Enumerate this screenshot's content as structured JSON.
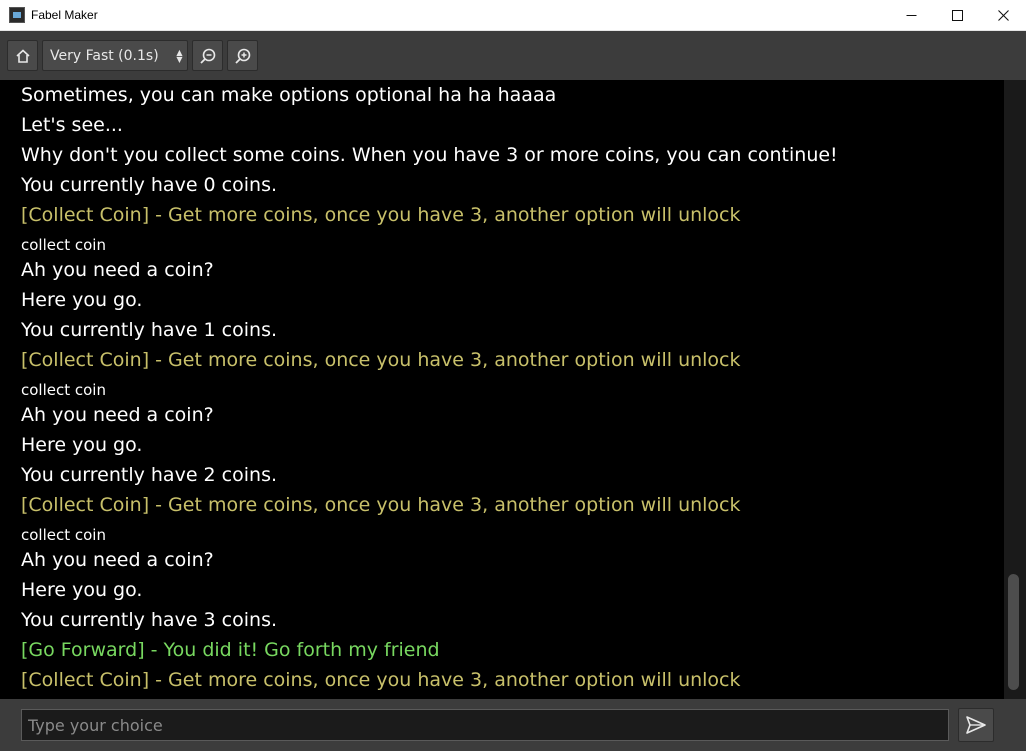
{
  "window": {
    "title": "Fabel Maker",
    "controls": {
      "minimize": "—",
      "maximize": "☐",
      "close": "✕"
    }
  },
  "toolbar": {
    "home_icon": "home-icon",
    "speed": {
      "selected": "Very Fast (0.1s)"
    },
    "zoom_out_icon": "zoom-out-icon",
    "zoom_in_icon": "zoom-in-icon"
  },
  "log": {
    "lines": [
      {
        "text": "Sometimes, you can make options optional ha ha haaaa",
        "kind": "narration"
      },
      {
        "text": "Let's see...",
        "kind": "narration"
      },
      {
        "text": "Why don't you collect some coins. When you have 3 or more coins, you can continue!",
        "kind": "narration"
      },
      {
        "text": "You currently have 0 coins.",
        "kind": "narration"
      },
      {
        "text": "[Collect Coin] - Get more coins, once you have 3, another option will unlock",
        "kind": "option"
      },
      {
        "text": "collect coin",
        "kind": "user"
      },
      {
        "text": "Ah you need a coin?",
        "kind": "narration"
      },
      {
        "text": "Here you go.",
        "kind": "narration"
      },
      {
        "text": "You currently have 1 coins.",
        "kind": "narration"
      },
      {
        "text": "[Collect Coin] - Get more coins, once you have 3, another option will unlock",
        "kind": "option"
      },
      {
        "text": "collect coin",
        "kind": "user"
      },
      {
        "text": "Ah you need a coin?",
        "kind": "narration"
      },
      {
        "text": "Here you go.",
        "kind": "narration"
      },
      {
        "text": "You currently have 2 coins.",
        "kind": "narration"
      },
      {
        "text": "[Collect Coin] - Get more coins, once you have 3, another option will unlock",
        "kind": "option"
      },
      {
        "text": "collect coin",
        "kind": "user"
      },
      {
        "text": "Ah you need a coin?",
        "kind": "narration"
      },
      {
        "text": "Here you go.",
        "kind": "narration"
      },
      {
        "text": "You currently have 3 coins.",
        "kind": "narration"
      },
      {
        "text": "[Go Forward] - You did it! Go forth my friend",
        "kind": "option-unlocked"
      },
      {
        "text": "[Collect Coin] - Get more coins, once you have 3, another option will unlock",
        "kind": "option"
      }
    ],
    "colors": {
      "narration": "#ffffff",
      "option": "#c8c06a",
      "option_unlocked": "#78d860",
      "background": "#000000"
    }
  },
  "input": {
    "placeholder": "Type your choice",
    "value": "",
    "send_icon": "send-icon"
  }
}
